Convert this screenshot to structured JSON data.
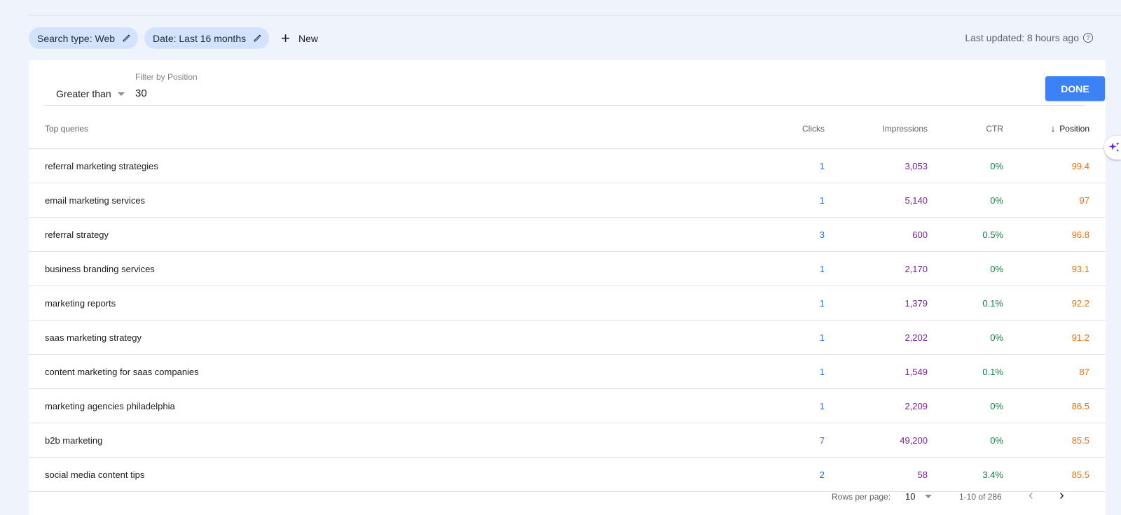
{
  "chips": [
    {
      "label": "Search type: Web",
      "icon": "pencil-icon"
    },
    {
      "label": "Date: Last 16 months",
      "icon": "pencil-icon"
    }
  ],
  "new_label": "New",
  "last_updated": "Last updated: 8 hours ago",
  "filter": {
    "operator": "Greater than",
    "label": "Filter by Position",
    "value": "30",
    "done_label": "DONE"
  },
  "table": {
    "headers": {
      "query": "Top queries",
      "clicks": "Clicks",
      "impressions": "Impressions",
      "ctr": "CTR",
      "position": "Position"
    },
    "sort": {
      "column": "position",
      "direction": "descending"
    },
    "rows": [
      {
        "query": "referral marketing strategies",
        "clicks": "1",
        "impressions": "3,053",
        "ctr": "0%",
        "position": "99.4"
      },
      {
        "query": "email marketing services",
        "clicks": "1",
        "impressions": "5,140",
        "ctr": "0%",
        "position": "97"
      },
      {
        "query": "referral strategy",
        "clicks": "3",
        "impressions": "600",
        "ctr": "0.5%",
        "position": "96.8"
      },
      {
        "query": "business branding services",
        "clicks": "1",
        "impressions": "2,170",
        "ctr": "0%",
        "position": "93.1"
      },
      {
        "query": "marketing reports",
        "clicks": "1",
        "impressions": "1,379",
        "ctr": "0.1%",
        "position": "92.2"
      },
      {
        "query": "saas marketing strategy",
        "clicks": "1",
        "impressions": "2,202",
        "ctr": "0%",
        "position": "91.2"
      },
      {
        "query": "content marketing for saas companies",
        "clicks": "1",
        "impressions": "1,549",
        "ctr": "0.1%",
        "position": "87"
      },
      {
        "query": "marketing agencies philadelphia",
        "clicks": "1",
        "impressions": "2,209",
        "ctr": "0%",
        "position": "86.5"
      },
      {
        "query": "b2b marketing",
        "clicks": "7",
        "impressions": "49,200",
        "ctr": "0%",
        "position": "85.5"
      },
      {
        "query": "social media content tips",
        "clicks": "2",
        "impressions": "58",
        "ctr": "3.4%",
        "position": "85.5"
      }
    ]
  },
  "pagination": {
    "rows_per_page_label": "Rows per page:",
    "rows_per_page": "10",
    "range": "1-10 of 286"
  },
  "colors": {
    "clicks": "#1a73e8",
    "impressions": "#7b1fa2",
    "ctr": "#0b8043",
    "position": "#e8710a",
    "done_button": "#3c82f6",
    "chip": "#d3e3fd"
  }
}
